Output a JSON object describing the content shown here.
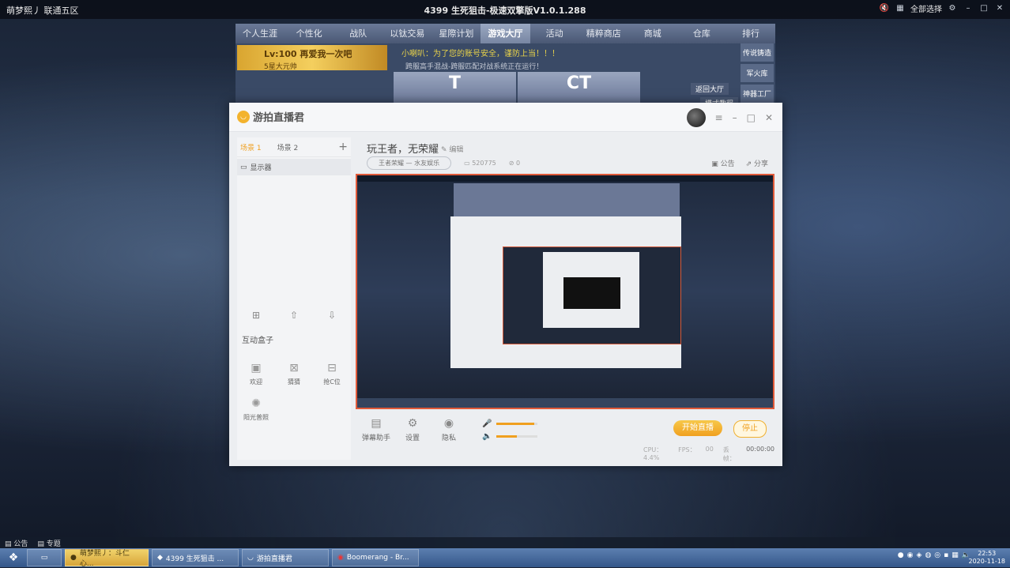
{
  "game_window": {
    "left_title": "萌梦熙丿 联通五区",
    "title": "4399 生死狙击-极速双擎版V1.0.1.288",
    "right_label": "全部选择"
  },
  "lobby": {
    "nav": [
      "个人生涯",
      "个性化",
      "战队",
      "以钛交易",
      "星際计划",
      "游戏大厅",
      "活动",
      "精粹商店",
      "商城",
      "仓库",
      "排行"
    ],
    "active_nav": "游戏大厅",
    "lv_text": "Lv:100 再爱我一次吧",
    "lv_sub": "5星大元帅",
    "notice": "小喇叭：为了您的账号安全，谨防上当！！！",
    "notice_sub": "跨服高手混战-跨服匹配对战系统正在运行！",
    "box_t": "T",
    "box_ct": "CT",
    "room_label": "返回大厅",
    "mode_label": "模式教程",
    "side_tabs": [
      "传说铸造",
      "军火库",
      "神器工厂"
    ]
  },
  "app": {
    "name": "游拍直播君",
    "scenes": [
      "场景 1",
      "场景 2"
    ],
    "source": "显示器",
    "box_title": "互动盒子",
    "box_items": [
      "欢迎",
      "猜猜",
      "抢C位",
      "阳光普照"
    ],
    "room_title": "玩王者，无荣耀",
    "edit": "编辑",
    "category": "王者荣耀 — 水友娱乐",
    "room_id": "520775",
    "viewers": "0",
    "announce": "公告",
    "share": "分享",
    "controls": [
      "弹幕助手",
      "设置",
      "隐私"
    ],
    "start_live": "开始直播",
    "stop": "停止",
    "stats": {
      "cpu": "CPU：4.4%",
      "fps": "FPS：",
      "fps_val": "00",
      "loss": "丢帧：",
      "time": "00:00:00"
    }
  },
  "bottom_strip": [
    "公告",
    "专题"
  ],
  "taskbar": {
    "items": [
      "萌梦熙丿：斗仁心...",
      "4399 生死狙击 ...",
      "游拍直播君",
      "Boomerang - Br..."
    ],
    "time": "22:53",
    "date": "2020-11-18"
  }
}
